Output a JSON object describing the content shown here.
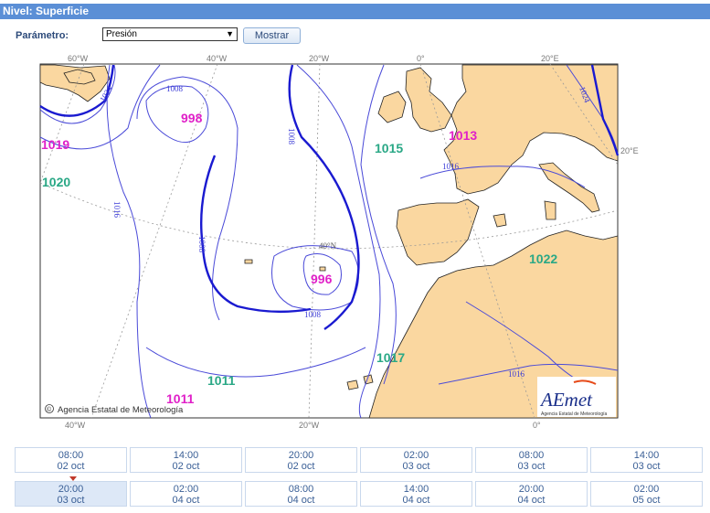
{
  "header": {
    "title": "Nivel: Superficie"
  },
  "controls": {
    "param_label": "Parámetro:",
    "param_value": "Presión",
    "show_label": "Mostrar"
  },
  "map": {
    "colors": {
      "land": "#fad7a0",
      "sea": "#ffffff",
      "isobar": "#3a3ad6",
      "high": "#2aa886",
      "low": "#e020c8"
    },
    "top_lon_labels": [
      "60°W",
      "40°W",
      "20°W",
      "0°",
      "20°E"
    ],
    "bottom_lon_labels": [
      "40°W",
      "20°W",
      "0°"
    ],
    "right_lat_label": "20°E",
    "lat_label": "40°N",
    "isobar_labels": [
      "1008",
      "1008",
      "1008",
      "1008",
      "1016",
      "1016",
      "1016",
      "1024",
      "1024"
    ],
    "centers": [
      {
        "value": "998",
        "type": "low"
      },
      {
        "value": "1019",
        "type": "low"
      },
      {
        "value": "1020",
        "type": "high"
      },
      {
        "value": "1015",
        "type": "high"
      },
      {
        "value": "1013",
        "type": "low"
      },
      {
        "value": "996",
        "type": "low"
      },
      {
        "value": "1022",
        "type": "high"
      },
      {
        "value": "1017",
        "type": "high"
      },
      {
        "value": "1011",
        "type": "high"
      },
      {
        "value": "1011",
        "type": "low"
      }
    ],
    "copyright": "Agencia Estatal de Meteorología",
    "copyright_symbol": "©",
    "logo_text": "AEmet",
    "logo_sub": "Agencia Estatal de Meteorología"
  },
  "times": {
    "row1": [
      {
        "time": "08:00",
        "date": "02 oct"
      },
      {
        "time": "14:00",
        "date": "02 oct"
      },
      {
        "time": "20:00",
        "date": "02 oct"
      },
      {
        "time": "02:00",
        "date": "03 oct"
      },
      {
        "time": "08:00",
        "date": "03 oct"
      },
      {
        "time": "14:00",
        "date": "03 oct"
      }
    ],
    "row2": [
      {
        "time": "20:00",
        "date": "03 oct",
        "selected": true
      },
      {
        "time": "02:00",
        "date": "04 oct"
      },
      {
        "time": "08:00",
        "date": "04 oct"
      },
      {
        "time": "14:00",
        "date": "04 oct"
      },
      {
        "time": "20:00",
        "date": "04 oct"
      },
      {
        "time": "02:00",
        "date": "05 oct"
      }
    ]
  }
}
